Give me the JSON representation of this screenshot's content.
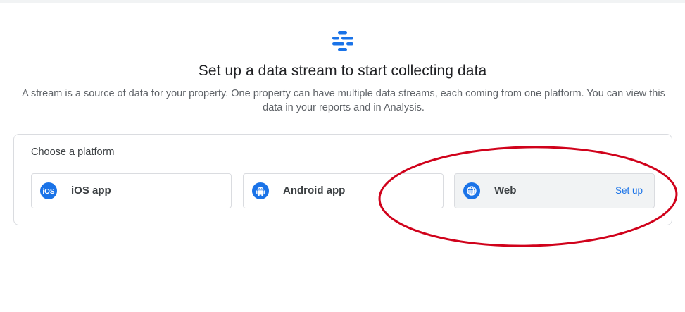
{
  "header": {
    "icon": "data-stream-icon",
    "title": "Set up a data stream to start collecting data",
    "description": "A stream is a source of data for your property. One property can have multiple data streams, each coming from one platform. You can view this data in your reports and in Analysis."
  },
  "platform_chooser": {
    "heading": "Choose a platform",
    "options": [
      {
        "label": "iOS app",
        "icon": "ios-icon",
        "selected": false
      },
      {
        "label": "Android app",
        "icon": "android-icon",
        "selected": false
      },
      {
        "label": "Web",
        "icon": "globe-icon",
        "selected": true,
        "action_label": "Set up"
      }
    ]
  },
  "colors": {
    "accent": "#1a73e8",
    "annotation": "#d0021b",
    "selected_bg": "#f1f3f4"
  }
}
